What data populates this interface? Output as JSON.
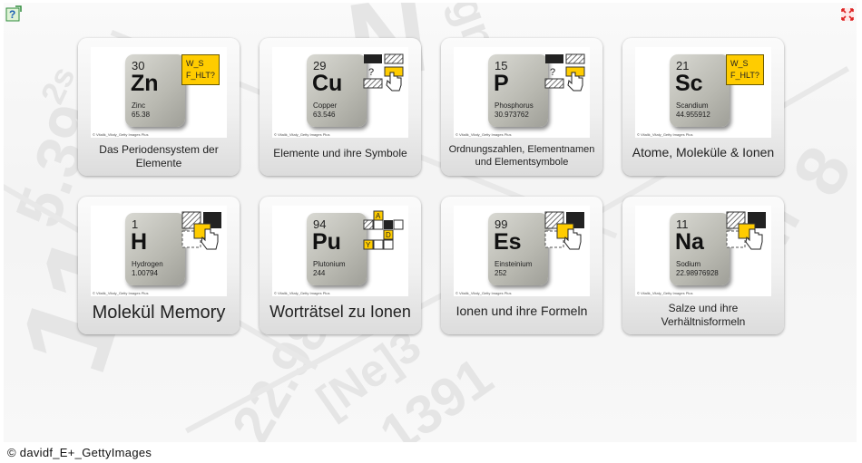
{
  "toolbar": {
    "help_icon": "help-icon",
    "fullscreen_icon": "fullscreen-icon"
  },
  "tiles": [
    {
      "title": "Das Periodensystem der Elemente",
      "element": {
        "number": "30",
        "symbol": "Zn",
        "name": "Zinc",
        "mass": "65.38"
      },
      "badge": [
        "W_S",
        "F_HLT?"
      ],
      "icon": "hint-badge-icon"
    },
    {
      "title": "Elemente und ihre Symbole",
      "element": {
        "number": "29",
        "symbol": "Cu",
        "name": "Copper",
        "mass": "63.546"
      },
      "icon": "assign-drag-icon"
    },
    {
      "title": "Ordnungszahlen, Elementnamen und Elementsymbole",
      "element": {
        "number": "15",
        "symbol": "P",
        "name": "Phosphorus",
        "mass": "30.973762"
      },
      "icon": "assign-drag-icon"
    },
    {
      "title": "Atome, Moleküle & Ionen",
      "element": {
        "number": "21",
        "symbol": "Sc",
        "name": "Scandium",
        "mass": "44.955912"
      },
      "badge": [
        "W_S",
        "F_HLT?"
      ],
      "icon": "hint-badge-icon"
    },
    {
      "title": "Molekül Memory",
      "element": {
        "number": "1",
        "symbol": "H",
        "name": "Hydrogen",
        "mass": "1.00794"
      },
      "icon": "memory-cards-icon"
    },
    {
      "title": "Worträtsel zu Ionen",
      "element": {
        "number": "94",
        "symbol": "Pu",
        "name": "Plutonium",
        "mass": "244"
      },
      "icon": "crossword-icon",
      "crossword_letters": [
        "A",
        "D",
        "Y"
      ]
    },
    {
      "title": "Ionen und ihre Formeln",
      "element": {
        "number": "99",
        "symbol": "Es",
        "name": "Einsteinium",
        "mass": "252"
      },
      "icon": "memory-cards-icon"
    },
    {
      "title": "Salze und ihre Verhältnisformeln",
      "element": {
        "number": "11",
        "symbol": "Na",
        "name": "Sodium",
        "mass": "22.98976928"
      },
      "icon": "memory-cards-icon"
    }
  ],
  "image_credit": "© Vitalik_Vitaly_Getty Images Plus",
  "copyright": "© davidf_E+_GettyImages"
}
